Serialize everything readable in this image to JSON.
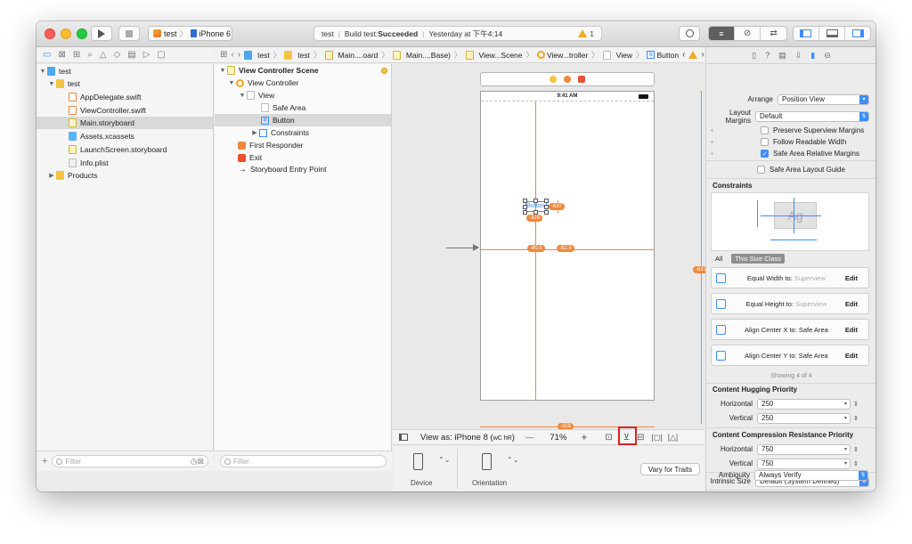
{
  "toolbar": {
    "scheme_target": "test",
    "scheme_device": "iPhone 6",
    "status": {
      "project": "test",
      "build_prefix": "Build test: ",
      "build_result": "Succeeded",
      "time": "Yesterday at 下午4:14",
      "warning_count": "1"
    }
  },
  "navigator": {
    "items": [
      {
        "label": "test"
      },
      {
        "label": "test"
      },
      {
        "label": "AppDelegate.swift"
      },
      {
        "label": "ViewController.swift"
      },
      {
        "label": "Main.storyboard"
      },
      {
        "label": "Assets.xcassets"
      },
      {
        "label": "LaunchScreen.storyboard"
      },
      {
        "label": "Info.plist"
      },
      {
        "label": "Products"
      }
    ],
    "filter_placeholder": "Filter"
  },
  "jumpbar": [
    "test",
    "test",
    "Main....oard",
    "Main....Base)",
    "View...Scene",
    "View...troller",
    "View",
    "Button"
  ],
  "outline": {
    "scene_title": "View Controller Scene",
    "items": [
      {
        "label": "View Controller"
      },
      {
        "label": "View"
      },
      {
        "label": "Safe Area"
      },
      {
        "label": "Button"
      },
      {
        "label": "Constraints"
      },
      {
        "label": "First Responder"
      },
      {
        "label": "Exit"
      },
      {
        "label": "Storyboard Entry Point"
      }
    ],
    "filter_placeholder": "Filter"
  },
  "canvas": {
    "status_time": "9:41 AM",
    "button_text": "Button",
    "labels": {
      "btn_right": "-637",
      "btn_bottom": "-329",
      "center_left": "-80.5",
      "center_right": "-82.5",
      "right_edge": "-637",
      "bottom_edge": "-329"
    }
  },
  "canvas_bar": {
    "view_as": "View as: iPhone 8 (",
    "traits": "wC hR",
    "view_as_close": ")",
    "zoom_minus": "—",
    "zoom": "71%",
    "zoom_plus": "+"
  },
  "device_bar": {
    "device": "Device",
    "orientation": "Orientation",
    "vary": "Vary for Traits"
  },
  "inspector": {
    "arrange_label": "Arrange",
    "arrange_value": "Position View",
    "layout_margins_label": "Layout Margins",
    "layout_margins_value": "Default",
    "checks": [
      {
        "label": "Preserve Superview Margins",
        "checked": false
      },
      {
        "label": "Follow Readable Width",
        "checked": false
      },
      {
        "label": "Safe Area Relative Margins",
        "checked": true
      },
      {
        "label": "Safe Area Layout Guide",
        "checked": false
      }
    ],
    "constraints_title": "Constraints",
    "preview_text": "Ag",
    "seg_all": "All",
    "seg_size_class": "This Size Class",
    "constraints": [
      {
        "title": "Equal Width to:",
        "target": "Superview",
        "edit": "Edit"
      },
      {
        "title": "Equal Height to:",
        "target": "Superview",
        "edit": "Edit"
      },
      {
        "title": "Align Center X to:",
        "target": "Safe Area",
        "edit": "Edit"
      },
      {
        "title": "Align Center Y to:",
        "target": "Safe Area",
        "edit": "Edit"
      }
    ],
    "showing": "Showing 4 of 4",
    "hugging_title": "Content Hugging Priority",
    "hugging_h_label": "Horizontal",
    "hugging_h": "250",
    "hugging_v_label": "Vertical",
    "hugging_v": "250",
    "compression_title": "Content Compression Resistance Priority",
    "compression_h_label": "Horizontal",
    "compression_h": "750",
    "compression_v_label": "Vertical",
    "compression_v": "750",
    "intrinsic_label": "Intrinsic Size",
    "intrinsic_value": "Default (System Defined)",
    "ambiguity_label": "Ambiguity",
    "ambiguity_value": "Always Verify"
  }
}
